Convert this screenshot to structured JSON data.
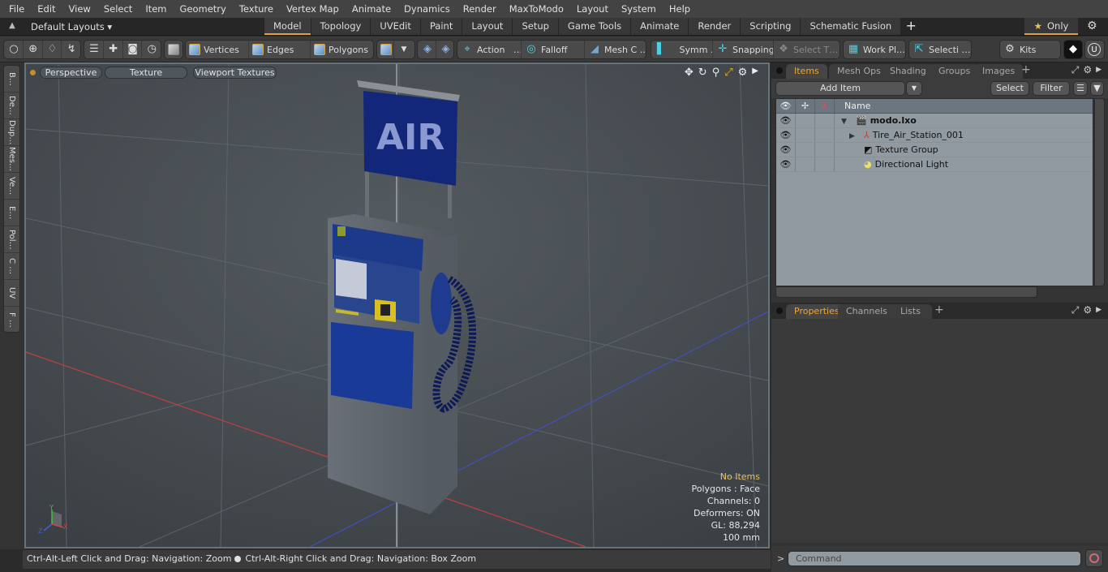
{
  "menubar": {
    "items": [
      "File",
      "Edit",
      "View",
      "Select",
      "Item",
      "Geometry",
      "Texture",
      "Vertex Map",
      "Animate",
      "Dynamics",
      "Render",
      "MaxToModo",
      "Layout",
      "System",
      "Help"
    ]
  },
  "layoutbar": {
    "layouts_label": "Default Layouts ▾",
    "tabs": [
      "Model",
      "Topology",
      "UVEdit",
      "Paint",
      "Layout",
      "Setup",
      "Game Tools",
      "Animate",
      "Render",
      "Scripting",
      "Schematic Fusion"
    ],
    "active_tab": "Model",
    "add_tab": "+",
    "only_label": "Only",
    "only_icon": "★"
  },
  "toolbar": {
    "vertices": "Vertices",
    "edges": "Edges",
    "polygons": "Polygons",
    "action": "Action",
    "action_more": "…",
    "falloff": "Falloff",
    "mesh_c": "Mesh C …",
    "symm": "Symm …",
    "snapping": "Snapping",
    "select_t": "Select T…",
    "work_pl": "Work Pl…",
    "selecti": "Selecti …",
    "kits": "Kits"
  },
  "side_tabs": [
    "B…",
    "De…",
    "Dup…",
    "Mes…",
    "Ve…",
    "E…",
    "Pol…",
    "C …",
    "UV",
    "F …"
  ],
  "viewport": {
    "view_mode": "Perspective",
    "shading": "Texture",
    "textures": "Viewport Textures",
    "info": {
      "selection": "No Items",
      "polygons": "Polygons : Face",
      "channels": "Channels: 0",
      "deformers": "Deformers: ON",
      "gl": "GL: 88,294",
      "scale": "100 mm"
    },
    "axis_labels": {
      "x": "X",
      "y": "Y",
      "z": "Z"
    },
    "sign_text": "AIR"
  },
  "statusbar": {
    "hint_left": "Ctrl-Alt-Left Click and Drag: Navigation: Zoom",
    "hint_right": "Ctrl-Alt-Right Click and Drag: Navigation: Box Zoom"
  },
  "items_panel": {
    "tabs": [
      "Items",
      "Mesh Ops",
      "Shading",
      "Groups",
      "Images"
    ],
    "active_tab": "Items",
    "add_item": "Add Item",
    "select": "Select",
    "filter": "Filter",
    "name_header": "Name",
    "rows": [
      {
        "name": "modo.lxo",
        "icon": "scene-icon",
        "expand": "▼",
        "bold": true,
        "indent": 0
      },
      {
        "name": "Tire_Air_Station_001",
        "icon": "mesh-locator-icon",
        "expand": "▶",
        "bold": false,
        "indent": 1
      },
      {
        "name": "Texture Group",
        "icon": "texture-group-icon",
        "expand": "",
        "bold": false,
        "indent": 1
      },
      {
        "name": "Directional Light",
        "icon": "light-icon",
        "expand": "",
        "bold": false,
        "indent": 1
      }
    ]
  },
  "props_panel": {
    "tabs": [
      "Properties",
      "Channels",
      "Lists"
    ],
    "active_tab": "Properties"
  },
  "command": {
    "prompt": ">",
    "placeholder": "Command"
  },
  "colors": {
    "accent": "#f0a530",
    "viewport_bg": "#4a5055",
    "tree_bg": "#929aa1",
    "x_axis": "#d84040",
    "y_axis": "#40c040",
    "z_axis": "#4060e0"
  }
}
